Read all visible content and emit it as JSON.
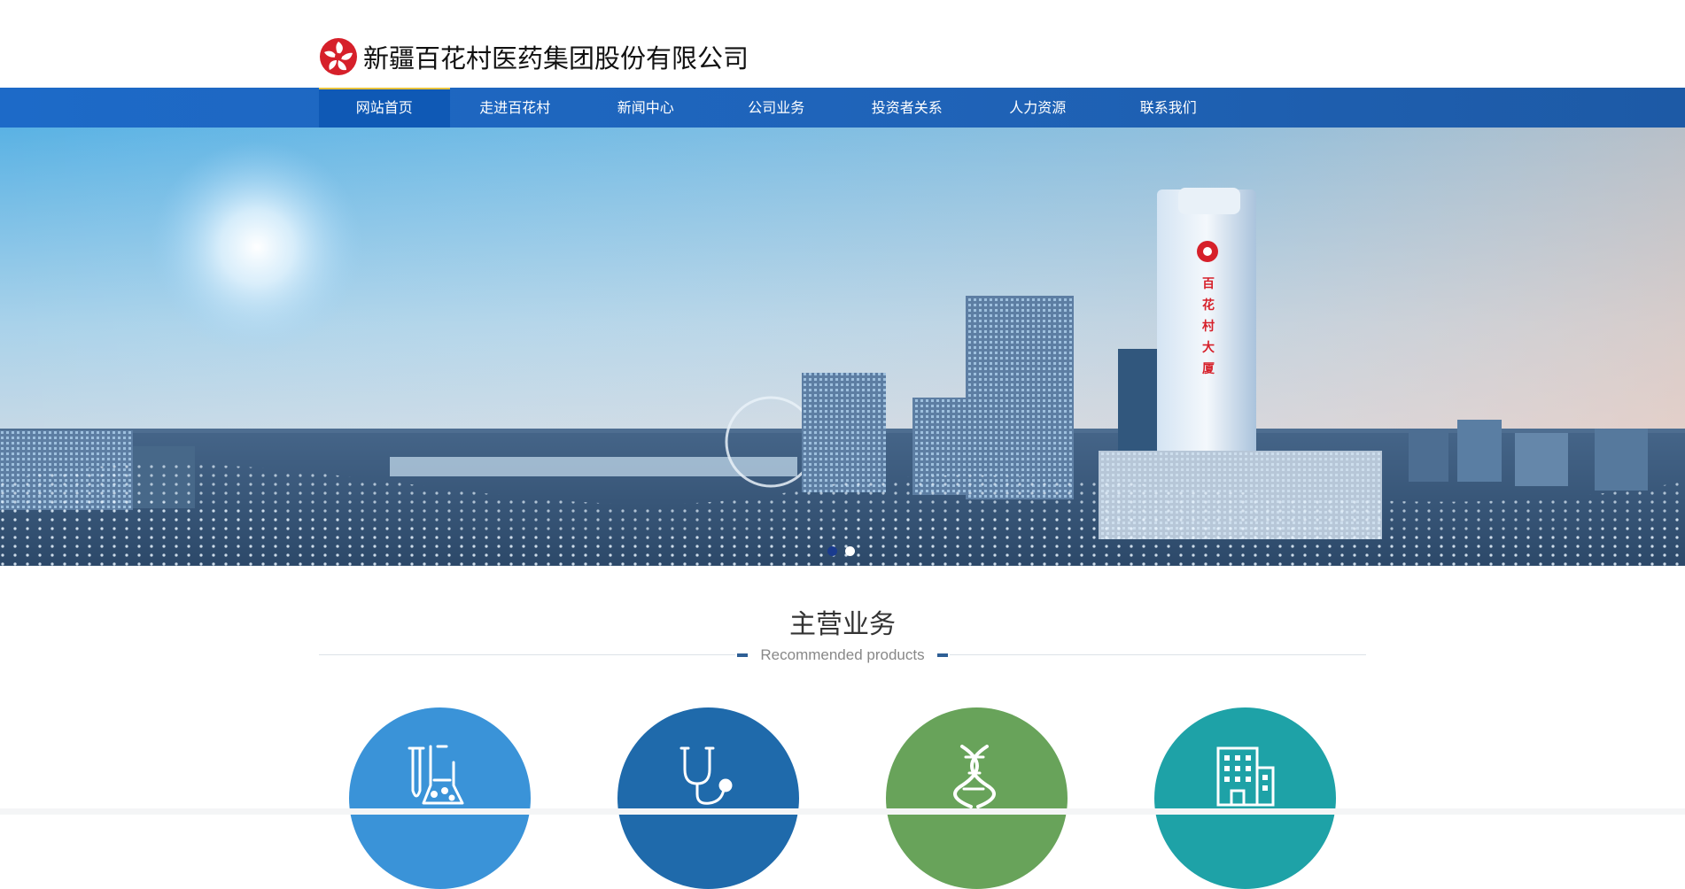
{
  "brand": {
    "company_name": "新疆百花村医药集团股份有限公司",
    "logo_icon": "baihuacun-logo-icon",
    "logo_color": "#d6202a"
  },
  "nav": {
    "active_index": 0,
    "items": [
      {
        "label": "网站首页"
      },
      {
        "label": "走进百花村"
      },
      {
        "label": "新闻中心"
      },
      {
        "label": "公司业务"
      },
      {
        "label": "投资者关系"
      },
      {
        "label": "人力资源"
      },
      {
        "label": "联系我们"
      }
    ],
    "bar_color": "#1e66c0",
    "active_accent": "#e7c23c"
  },
  "banner": {
    "building_sign": [
      "百",
      "花",
      "村",
      "大",
      "厦"
    ],
    "slide_count": 2,
    "active_slide": 0
  },
  "section": {
    "title": "主营业务",
    "subtitle": "Recommended products"
  },
  "business": [
    {
      "icon": "lab-flask-icon",
      "color": "#3a93d8"
    },
    {
      "icon": "stethoscope-icon",
      "color": "#1f6aab"
    },
    {
      "icon": "dna-icon",
      "color": "#68a35a"
    },
    {
      "icon": "hospital-building-icon",
      "color": "#1ea2a7"
    }
  ]
}
